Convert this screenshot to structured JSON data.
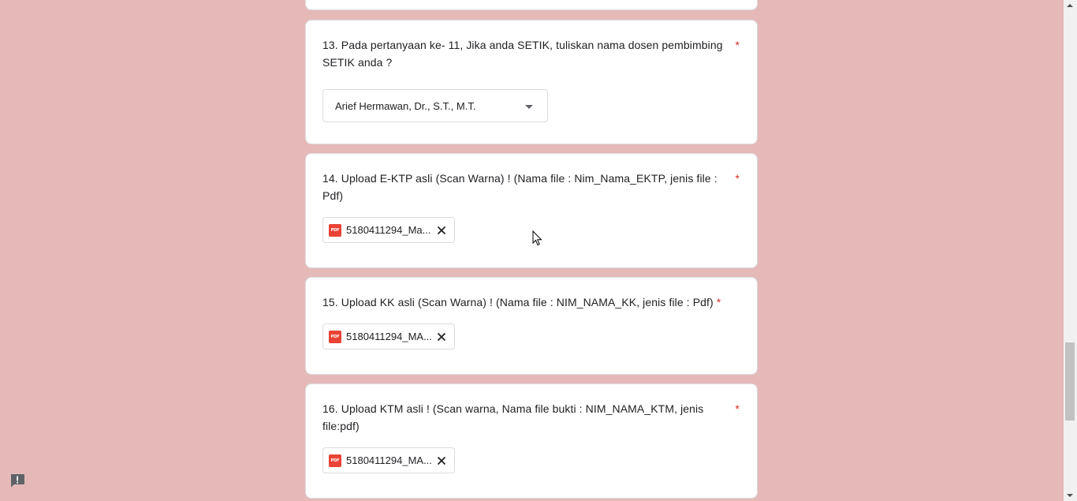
{
  "required_marker": "*",
  "questions": [
    {
      "title": "13. Pada pertanyaan ke- 11, Jika anda SETIK, tuliskan nama dosen pembimbing SETIK anda ?",
      "type": "dropdown",
      "selected_value": "Arief Hermawan, Dr., S.T., M.T."
    },
    {
      "title": "14. Upload E-KTP asli (Scan Warna) ! (Nama file : Nim_Nama_EKTP, jenis file : Pdf)",
      "type": "file_upload",
      "file_name": "5180411294_Ma..."
    },
    {
      "title": "15.  Upload KK asli (Scan Warna) ! (Nama file : NIM_NAMA_KK, jenis file : Pdf)",
      "type": "file_upload",
      "file_name": "5180411294_MA..."
    },
    {
      "title": "16. Upload KTM asli ! (Scan warna, Nama file bukti : NIM_NAMA_KTM, jenis file:pdf)",
      "type": "file_upload",
      "file_name": "5180411294_MA..."
    }
  ],
  "pdf_icon_label": "PDF",
  "colors": {
    "background": "#e6b9b9",
    "required": "#d93025",
    "pdf_icon": "#ea4335"
  },
  "icons": [
    "pdf-icon",
    "remove-file-icon",
    "dropdown-arrow-icon",
    "report-feedback-icon",
    "mouse-cursor-icon"
  ]
}
